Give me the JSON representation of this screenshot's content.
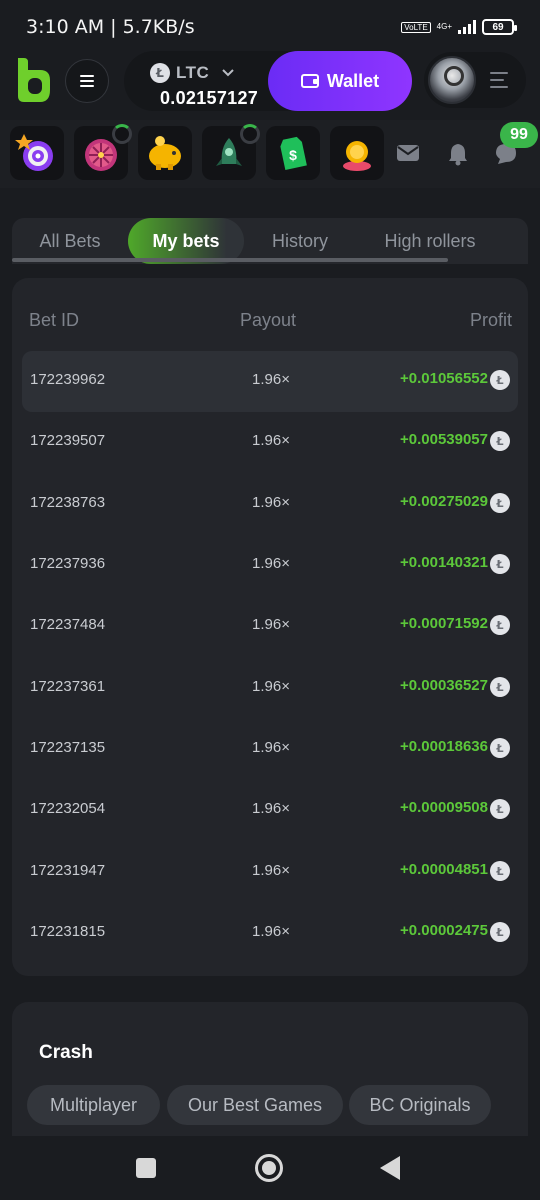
{
  "status_bar": {
    "time": "3:10 AM | 5.7KB/s",
    "volte": "VoLTE",
    "network": "4G+",
    "battery": "69"
  },
  "header": {
    "coin": "LTC",
    "coin_symbol": "Ł",
    "balance": "0.02157127",
    "wallet_label": "Wallet"
  },
  "icon_row": {
    "chat_badge": "99"
  },
  "tabs": [
    {
      "label": "All Bets",
      "active": false
    },
    {
      "label": "My bets",
      "active": true
    },
    {
      "label": "History",
      "active": false
    },
    {
      "label": "High rollers",
      "active": false
    }
  ],
  "bets": {
    "columns": {
      "id": "Bet ID",
      "payout": "Payout",
      "profit": "Profit"
    },
    "rows": [
      {
        "id": "172239962",
        "payout": "1.96×",
        "profit": "+0.01056552"
      },
      {
        "id": "172239507",
        "payout": "1.96×",
        "profit": "+0.00539057"
      },
      {
        "id": "172238763",
        "payout": "1.96×",
        "profit": "+0.00275029"
      },
      {
        "id": "172237936",
        "payout": "1.96×",
        "profit": "+0.00140321"
      },
      {
        "id": "172237484",
        "payout": "1.96×",
        "profit": "+0.00071592"
      },
      {
        "id": "172237361",
        "payout": "1.96×",
        "profit": "+0.00036527"
      },
      {
        "id": "172237135",
        "payout": "1.96×",
        "profit": "+0.00018636"
      },
      {
        "id": "172232054",
        "payout": "1.96×",
        "profit": "+0.00009508"
      },
      {
        "id": "172231947",
        "payout": "1.96×",
        "profit": "+0.00004851"
      },
      {
        "id": "172231815",
        "payout": "1.96×",
        "profit": "+0.00002475"
      }
    ]
  },
  "crash": {
    "title": "Crash",
    "chips": [
      "Multiplayer",
      "Our Best Games",
      "BC Originals"
    ]
  },
  "colors": {
    "accent_green": "#5cc83a",
    "wallet_purple": "#7a30fa",
    "badge_green": "#3ab54a"
  }
}
